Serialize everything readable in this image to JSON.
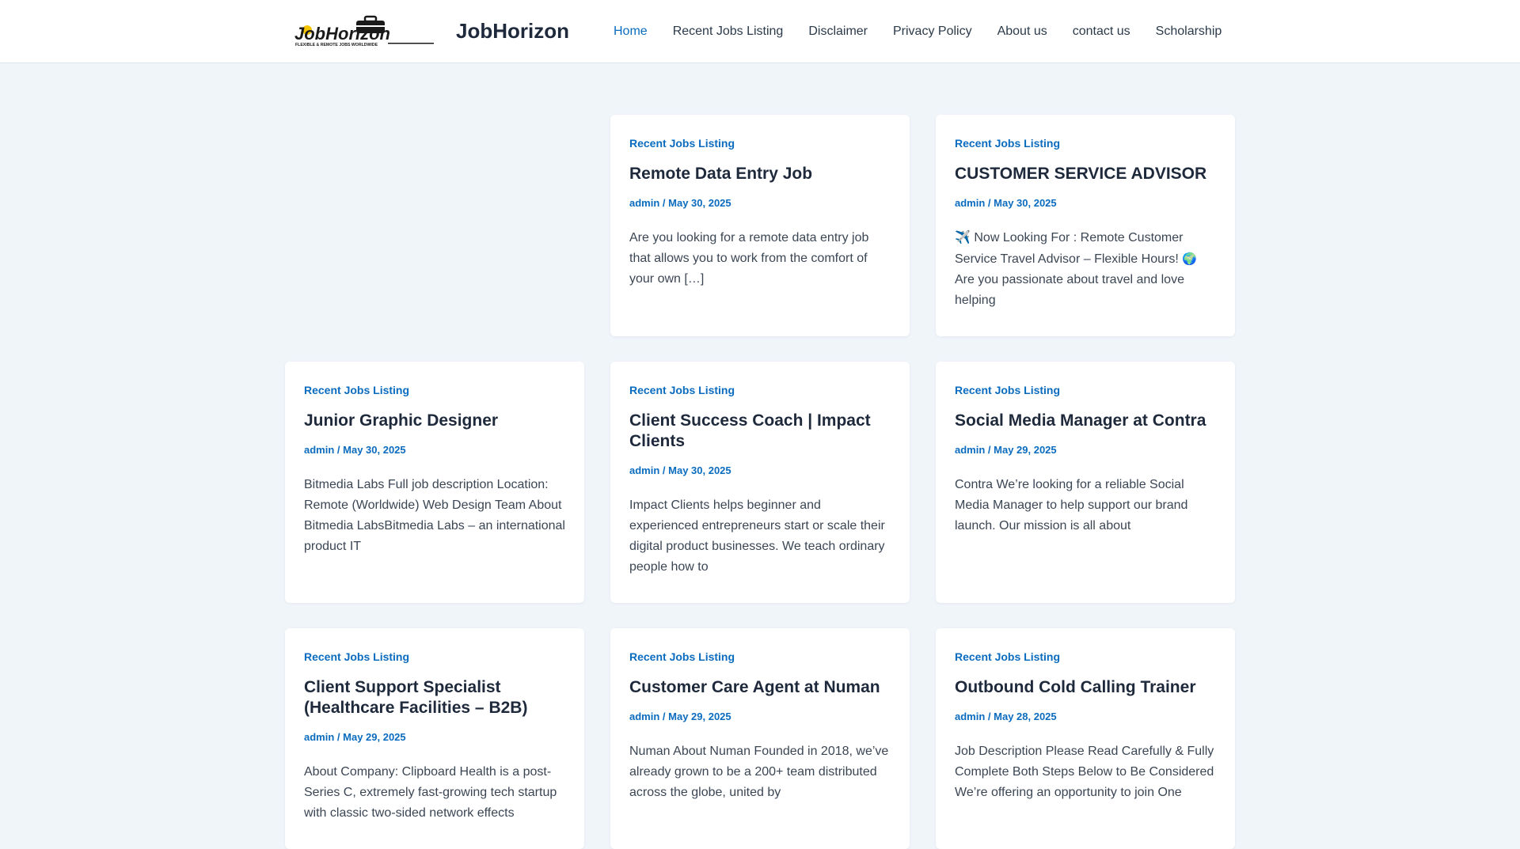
{
  "header": {
    "logo_text": "JobHorizon",
    "logo_tagline": "FLEXIBLE & REMOTE JOBS WORLDWIDE",
    "site_title": "JobHorizon"
  },
  "nav": {
    "items": [
      {
        "label": "Home",
        "active": true
      },
      {
        "label": "Recent Jobs Listing"
      },
      {
        "label": "Disclaimer"
      },
      {
        "label": "Privacy Policy"
      },
      {
        "label": "About us"
      },
      {
        "label": "contact us"
      },
      {
        "label": "Scholarship"
      }
    ]
  },
  "posts": [
    {
      "category": "Recent Jobs Listing",
      "title": "Remote Data Entry Job",
      "author": "admin",
      "date": "May 30, 2025",
      "excerpt": "Are you looking for a remote data entry job that allows you to work from the comfort of your own […]"
    },
    {
      "category": "Recent Jobs Listing",
      "title": "CUSTOMER SERVICE ADVISOR",
      "author": "admin",
      "date": "May 30, 2025",
      "excerpt_pre": "✈️ Now Looking For : Remote Customer Service Travel Advisor – Flexible Hours! ",
      "excerpt_emoji": "🌍",
      "excerpt_post": " Are you passionate about travel and love helping"
    },
    {
      "category": "Recent Jobs Listing",
      "title": "Junior Graphic Designer",
      "author": "admin",
      "date": "May 30, 2025",
      "excerpt": "Bitmedia Labs Full job description Location: Remote (Worldwide) Web Design Team About Bitmedia LabsBitmedia Labs – an international product IT"
    },
    {
      "category": "Recent Jobs Listing",
      "title": "Client Success Coach | Impact Clients",
      "author": "admin",
      "date": "May 30, 2025",
      "excerpt": "Impact Clients helps beginner and experienced entrepreneurs start or scale their digital product businesses. We teach ordinary people how to"
    },
    {
      "category": "Recent Jobs Listing",
      "title": "Social Media Manager at Contra",
      "author": "admin",
      "date": "May 29, 2025",
      "excerpt": "Contra We’re looking for a reliable Social Media Manager to help support our brand launch. Our mission is all about"
    },
    {
      "category": "Recent Jobs Listing",
      "title": "Client Support Specialist (Healthcare Facilities – B2B)",
      "author": "admin",
      "date": "May 29, 2025",
      "excerpt": "About Company: Clipboard Health is a post-Series C, extremely fast-growing tech startup with classic two-sided network effects"
    },
    {
      "category": "Recent Jobs Listing",
      "title": "Customer Care Agent at Numan",
      "author": "admin",
      "date": "May 29, 2025",
      "excerpt": "Numan About Numan Founded in 2018, we’ve already grown to be a 200+ team distributed across the globe, united by"
    },
    {
      "category": "Recent Jobs Listing",
      "title": "Outbound Cold Calling Trainer",
      "author": "admin",
      "date": "May 28, 2025",
      "excerpt": "Job Description Please Read Carefully & Fully Complete Both Steps Below to Be Considered We’re offering an opportunity to join One"
    }
  ],
  "colors": {
    "accent": "#0b6cbf",
    "background": "#f0f5fa",
    "text": "#1e293b"
  }
}
